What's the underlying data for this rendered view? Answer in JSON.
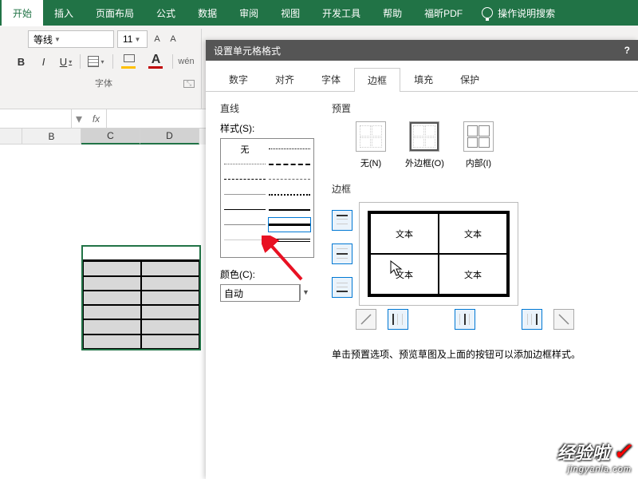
{
  "ribbon": {
    "tabs": [
      "开始",
      "插入",
      "页面布局",
      "公式",
      "数据",
      "审阅",
      "视图",
      "开发工具",
      "帮助",
      "福昕PDF"
    ],
    "active_index": 0,
    "tell_me": "操作说明搜索"
  },
  "font_group": {
    "font_name": "等线",
    "font_size": "11",
    "bold": "B",
    "italic": "I",
    "underline": "U",
    "font_color_letter": "A",
    "wen": "wén",
    "group_label": "字体"
  },
  "formula_bar": {
    "fx": "fx",
    "name_value": ""
  },
  "columns": [
    "B",
    "C",
    "D"
  ],
  "dialog": {
    "title": "设置单元格格式",
    "help": "?",
    "tabs": [
      "数字",
      "对齐",
      "字体",
      "边框",
      "填充",
      "保护"
    ],
    "active_tab_index": 3,
    "line_section": "直线",
    "style_label": "样式(S):",
    "style_none": "无",
    "color_label": "颜色(C):",
    "color_value": "自动",
    "preset_section": "预置",
    "presets": {
      "none": "无(N)",
      "outline": "外边框(O)",
      "inside": "内部(I)"
    },
    "border_section": "边框",
    "preview_text": "文本",
    "hint": "单击预置选项、预览草图及上面的按钮可以添加边框样式。"
  },
  "watermark": {
    "brand": "经验啦",
    "url": "jingyanla.com"
  }
}
